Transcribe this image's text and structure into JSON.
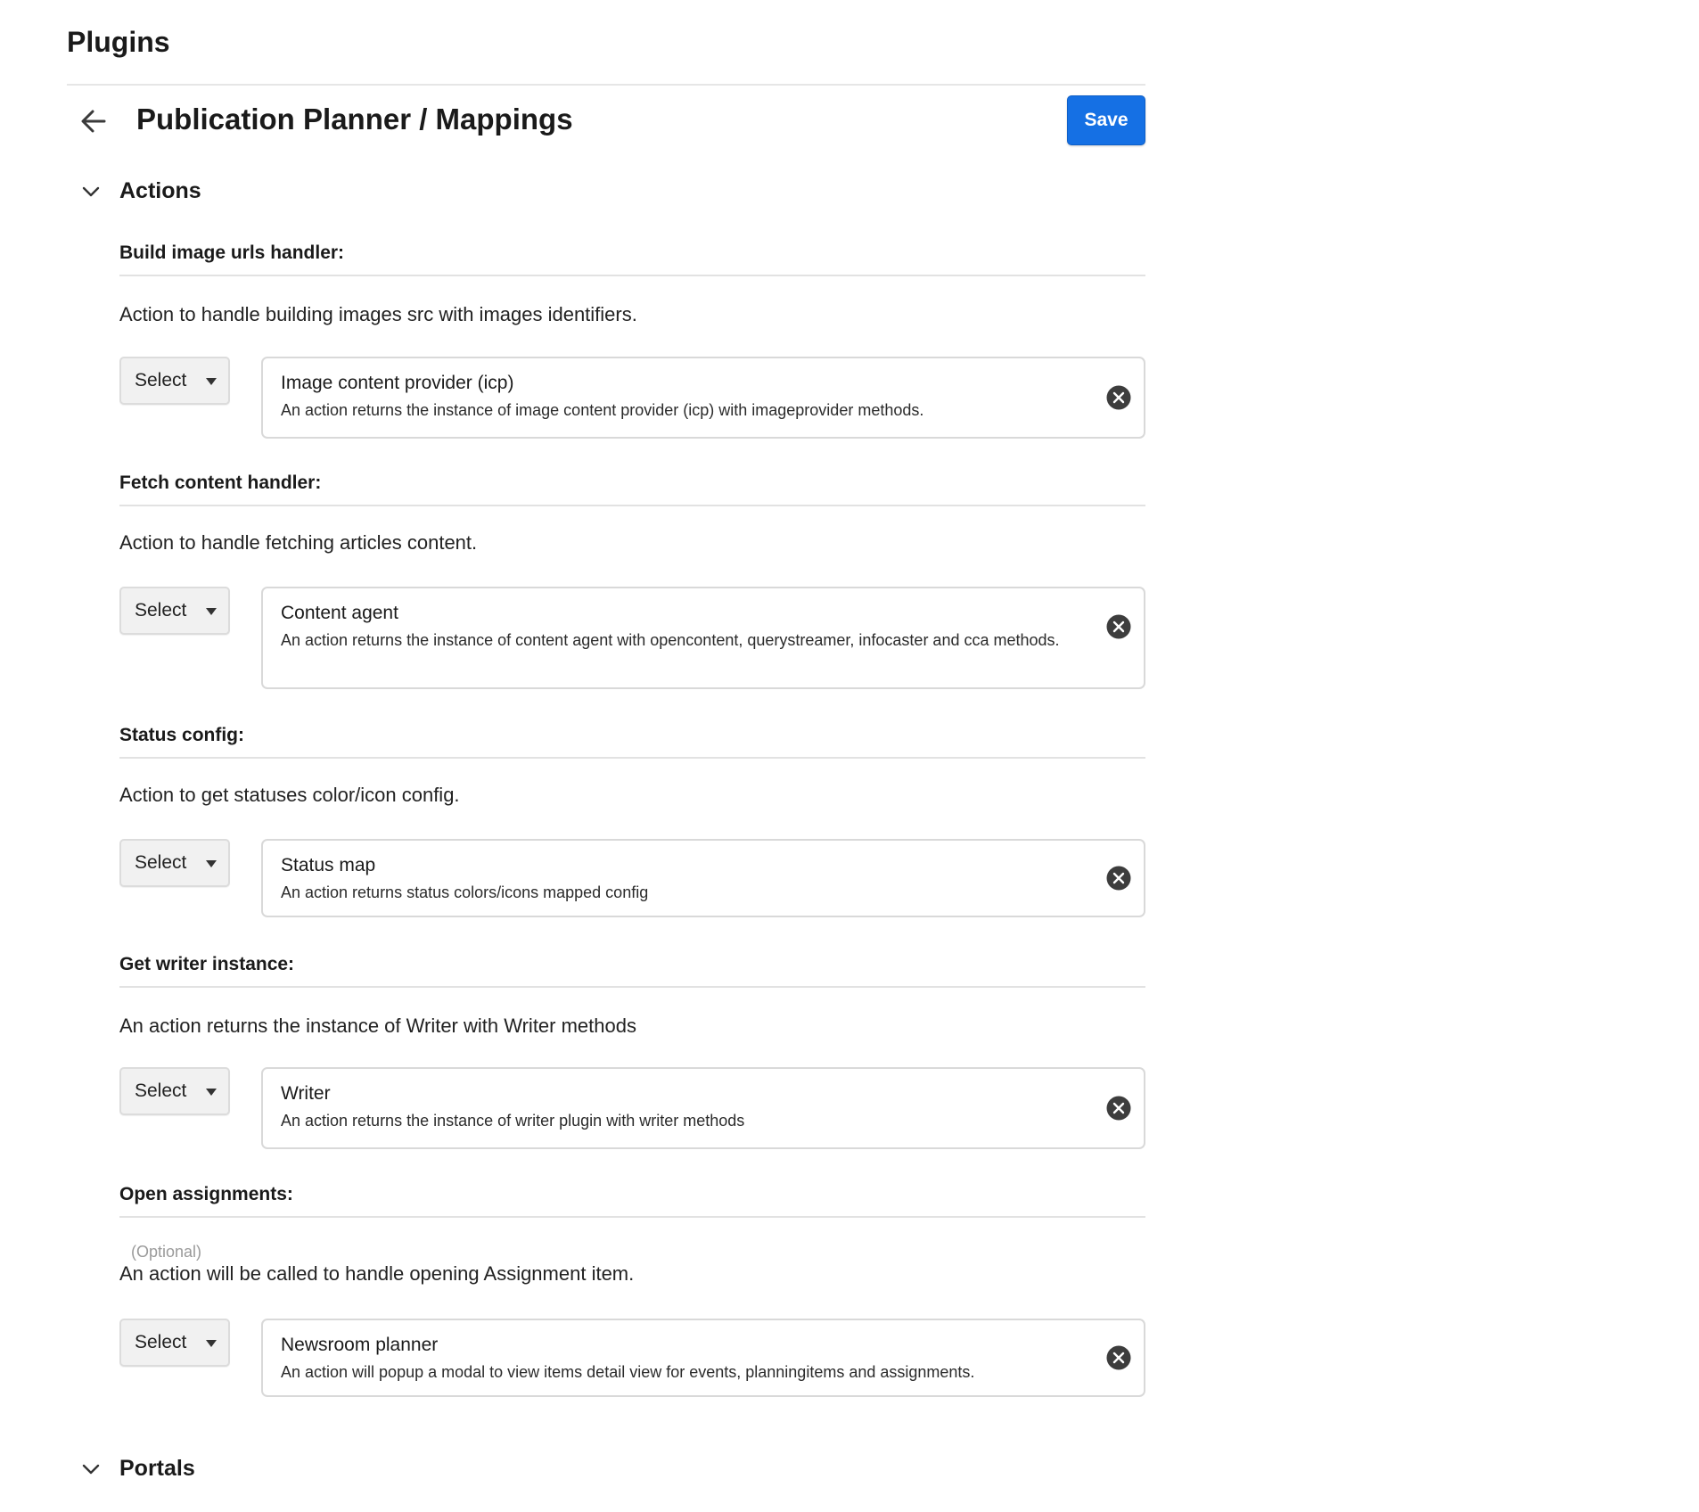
{
  "page": {
    "title": "Plugins"
  },
  "header": {
    "title": "Publication Planner / Mappings",
    "save_label": "Save"
  },
  "sections": {
    "actions": {
      "label": "Actions",
      "expanded": true
    },
    "portals": {
      "label": "Portals",
      "expanded": true
    }
  },
  "groups": [
    {
      "title": "Build image urls handler:",
      "description": "Action to handle building images src with images identifiers.",
      "select_label": "Select",
      "item": {
        "title": "Image content provider (icp)",
        "description": "An action returns the instance of image content provider (icp) with imageprovider methods."
      }
    },
    {
      "title": "Fetch content handler:",
      "description": "Action to handle fetching articles content.",
      "select_label": "Select",
      "item": {
        "title": "Content agent",
        "description": "An action returns the instance of content agent with opencontent, querystreamer, infocaster and cca methods."
      }
    },
    {
      "title": "Status config:",
      "description": "Action to get statuses color/icon config.",
      "select_label": "Select",
      "item": {
        "title": "Status map",
        "description": "An action returns status colors/icons mapped config"
      }
    },
    {
      "title": "Get writer instance:",
      "description": "An action returns the instance of Writer with Writer methods",
      "select_label": "Select",
      "item": {
        "title": "Writer",
        "description": "An action returns the instance of writer plugin with writer methods"
      }
    },
    {
      "title": "Open assignments:",
      "optional_label": "(Optional)",
      "description": "An action will be called to handle opening Assignment item.",
      "select_label": "Select",
      "item": {
        "title": "Newsroom planner",
        "description": "An action will popup a modal to view items detail view for events, planningitems and assignments."
      }
    }
  ],
  "icons": {
    "back": "arrow-left-icon",
    "chevron": "chevron-down-icon",
    "clear": "close-circle-icon",
    "caret": "caret-down-icon"
  },
  "colors": {
    "primary": "#1570e4",
    "border": "#d9d9d9",
    "clear_icon": "#3d3d3d"
  }
}
